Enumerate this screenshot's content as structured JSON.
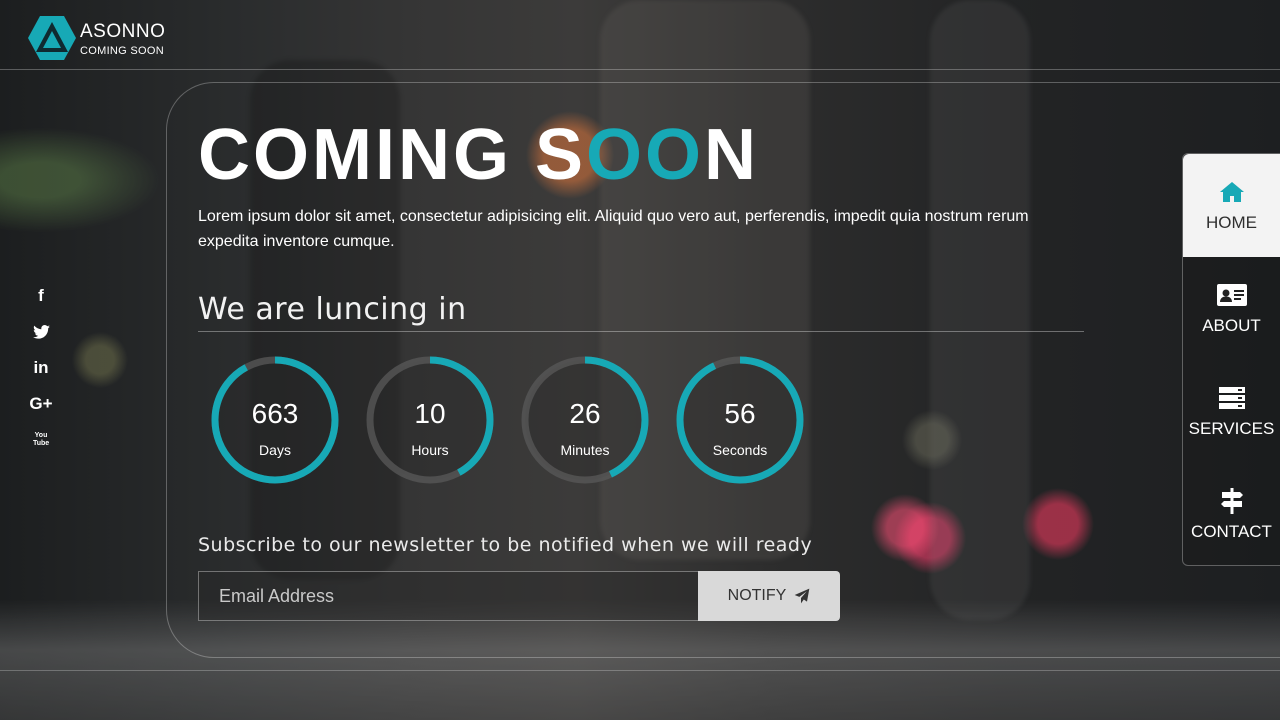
{
  "brand": {
    "name": "ASONNO",
    "tagline": "COMING SOON",
    "accent": "#17a9b6"
  },
  "hero": {
    "title_part1": "COMING S",
    "title_accent": "OO",
    "title_part2": "N",
    "description": "Lorem ipsum dolor sit amet, consectetur adipisicing elit. Aliquid quo vero aut, perferendis, impedit quia nostrum rerum expedita inventore cumque."
  },
  "launch_heading": "We are luncing in",
  "countdown": [
    {
      "value": "663",
      "label": "Days",
      "progress": 0.92
    },
    {
      "value": "10",
      "label": "Hours",
      "progress": 0.42
    },
    {
      "value": "26",
      "label": "Minutes",
      "progress": 0.43
    },
    {
      "value": "56",
      "label": "Seconds",
      "progress": 0.93
    }
  ],
  "subscribe": {
    "heading": "Subscribe to our newsletter to be notified when we will ready",
    "placeholder": "Email Address",
    "button_label": "NOTIFY"
  },
  "social": [
    {
      "glyph": "f",
      "icon": "facebook-icon"
    },
    {
      "glyph": "t",
      "icon": "twitter-icon"
    },
    {
      "glyph": "in",
      "icon": "linkedin-icon"
    },
    {
      "glyph": "G+",
      "icon": "google-plus-icon"
    },
    {
      "glyph": "You Tube",
      "icon": "youtube-icon"
    }
  ],
  "nav": [
    {
      "label": "HOME",
      "icon": "home-icon",
      "active": true
    },
    {
      "label": "ABOUT",
      "icon": "id-card-icon",
      "active": false
    },
    {
      "label": "SERVICES",
      "icon": "server-icon",
      "active": false
    },
    {
      "label": "CONTACT",
      "icon": "signpost-icon",
      "active": false
    }
  ]
}
